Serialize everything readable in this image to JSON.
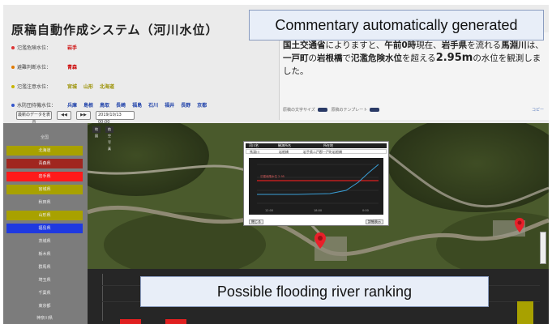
{
  "app": {
    "title": "原稿自動作成システム（河川水位）"
  },
  "levels": [
    {
      "label": "氾濫危険水位：",
      "values": [
        "岩手"
      ],
      "dot_color": "#d33"
    },
    {
      "label": "避難判断水位：",
      "values": [
        "青森"
      ],
      "dot_color": "#e07a00"
    },
    {
      "label": "氾濫注意水位：",
      "values": [
        "宮城",
        "山形",
        "北海道"
      ],
      "dot_color": "#c8b400"
    },
    {
      "label": "水防団待機水位：",
      "values": [
        "兵庫",
        "島根",
        "鳥取",
        "長崎",
        "福島",
        "石川",
        "福井",
        "長野",
        "京都"
      ],
      "dot_color": "#3355cc"
    }
  ],
  "controls": {
    "source_button": "最新のデータを表示",
    "prev": "◀◀",
    "next": "▶▶",
    "datetime_field": "2019/10/13 00:00"
  },
  "commentary": {
    "text_parts": [
      {
        "t": "国土交通省",
        "b": true
      },
      {
        "t": "によりますと、",
        "b": false
      },
      {
        "t": "午前0時",
        "b": true
      },
      {
        "t": "現在、",
        "b": false
      },
      {
        "t": "岩手県",
        "b": true
      },
      {
        "t": "を流れる",
        "b": false
      },
      {
        "t": "馬淵川",
        "b": true
      },
      {
        "t": "は、",
        "b": false
      },
      {
        "t": "一戸町",
        "b": true
      },
      {
        "t": "の",
        "b": false
      },
      {
        "t": "岩根橋",
        "b": true
      },
      {
        "t": "で",
        "b": false
      },
      {
        "t": "氾濫危険水位",
        "b": true
      },
      {
        "t": "を超える",
        "b": false
      },
      {
        "t": "2.95m",
        "b": true
      },
      {
        "t": "の水位を観測しました。",
        "b": false
      }
    ],
    "footer_font_size_label": "原稿の文字サイズ",
    "footer_template_label": "原稿のテンプレート",
    "footer_copy": "コピー"
  },
  "map": {
    "toolbar": [
      "地図",
      "航空写真"
    ],
    "popup": {
      "head": [
        "河川名",
        "観測所名",
        "所在地"
      ],
      "row": [
        "馬淵川",
        "岩根橋",
        "岩手県二戸郡一戸町岩根橋"
      ],
      "chart_line_label": "氾濫危険水位 2.95",
      "x_ticks": [
        "12:00",
        "18:00",
        "0:00"
      ],
      "btn_left": "閉じる",
      "btn_right": "詳細表示"
    }
  },
  "sidebar": {
    "items": [
      {
        "label": "全国",
        "bg": "#7c7c7c"
      },
      {
        "label": "北海道",
        "bg": "#a8a100"
      },
      {
        "label": "青森県",
        "bg": "#a0261f"
      },
      {
        "label": "岩手県",
        "bg": "#ff1a1a"
      },
      {
        "label": "宮城県",
        "bg": "#a8a100"
      },
      {
        "label": "秋田県",
        "bg": "#7c7c7c"
      },
      {
        "label": "山形県",
        "bg": "#a8a100"
      },
      {
        "label": "福島県",
        "bg": "#1f39e0"
      },
      {
        "label": "茨城県",
        "bg": "#7c7c7c"
      },
      {
        "label": "栃木県",
        "bg": "#7c7c7c"
      },
      {
        "label": "群馬県",
        "bg": "#7c7c7c"
      },
      {
        "label": "埼玉県",
        "bg": "#7c7c7c"
      },
      {
        "label": "千葉県",
        "bg": "#7c7c7c"
      },
      {
        "label": "東京都",
        "bg": "#7c7c7c"
      },
      {
        "label": "神奈川県",
        "bg": "#7c7c7c"
      }
    ]
  },
  "callouts": {
    "commentary": "Commentary automatically generated",
    "ranking": "Possible flooding river ranking"
  },
  "colors": {
    "danger": "#e02020",
    "warning": "#a8a100",
    "map_marker": "#e8202a"
  }
}
